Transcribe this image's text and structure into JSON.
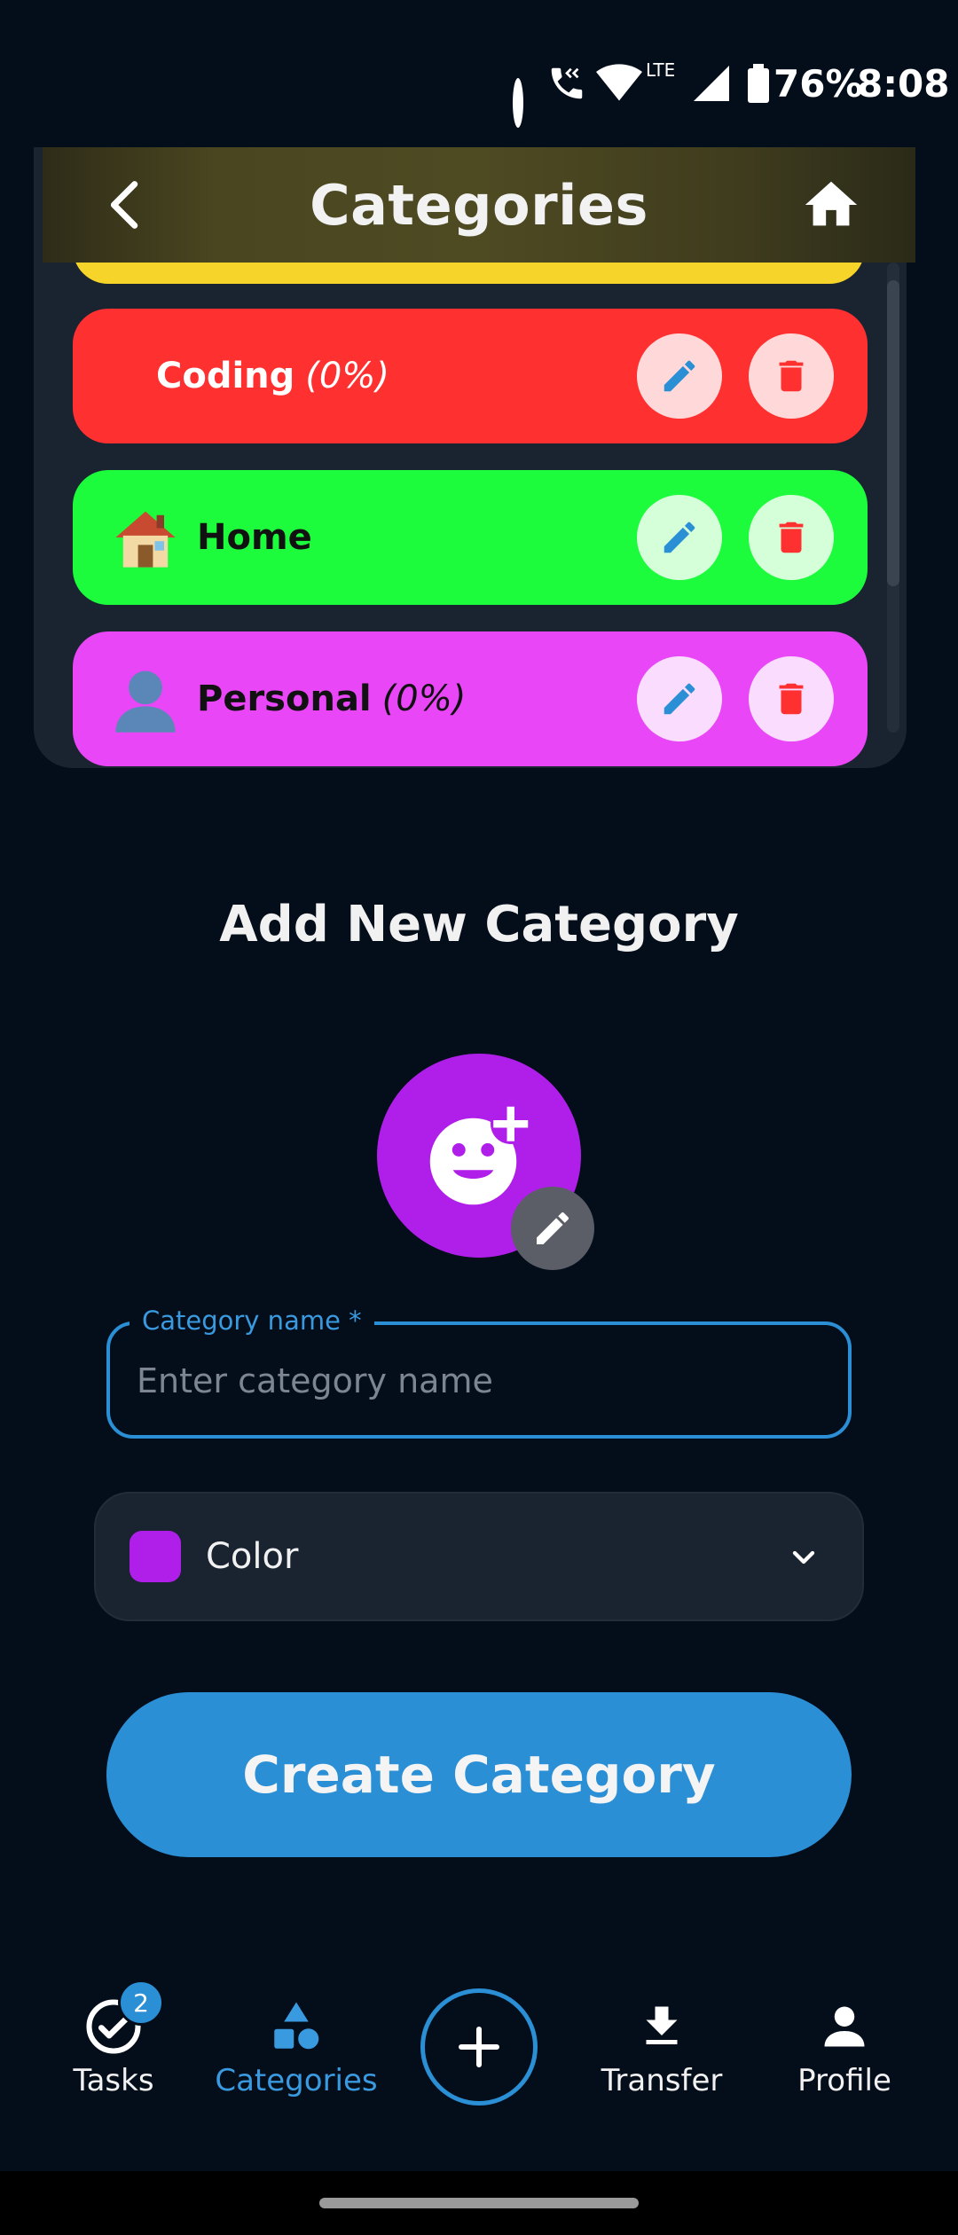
{
  "status_bar": {
    "network": "LTE",
    "battery": "76%",
    "time": "8:08"
  },
  "header": {
    "title": "Categories"
  },
  "categories": [
    {
      "name": "Coding",
      "percent": "(0%)",
      "emoji": "",
      "color": "#ff3030",
      "text_color": "#ffffff"
    },
    {
      "name": "Home",
      "percent": "",
      "emoji": "🏠",
      "color": "#1dfc3c",
      "text_color": "#111111"
    },
    {
      "name": "Personal",
      "percent": "(0%)",
      "emoji": "👤",
      "color": "#e846f6",
      "text_color": "#111111"
    }
  ],
  "add_section": {
    "title": "Add New Category",
    "name_field": {
      "label": "Category name *",
      "placeholder": "Enter category name",
      "value": ""
    },
    "color_select": {
      "label": "Color",
      "swatch": "#b01fe9"
    },
    "create_button": "Create Category"
  },
  "bottom_nav": {
    "tasks": {
      "label": "Tasks",
      "badge": "2"
    },
    "categories": {
      "label": "Categories"
    },
    "transfer": {
      "label": "Transfer"
    },
    "profile": {
      "label": "Profile"
    }
  },
  "colors": {
    "accent": "#2b8fd6",
    "background": "#040d1a",
    "panel": "#1a2330",
    "edit_icon": "#2b8fd6",
    "delete_icon": "#ff3030"
  }
}
